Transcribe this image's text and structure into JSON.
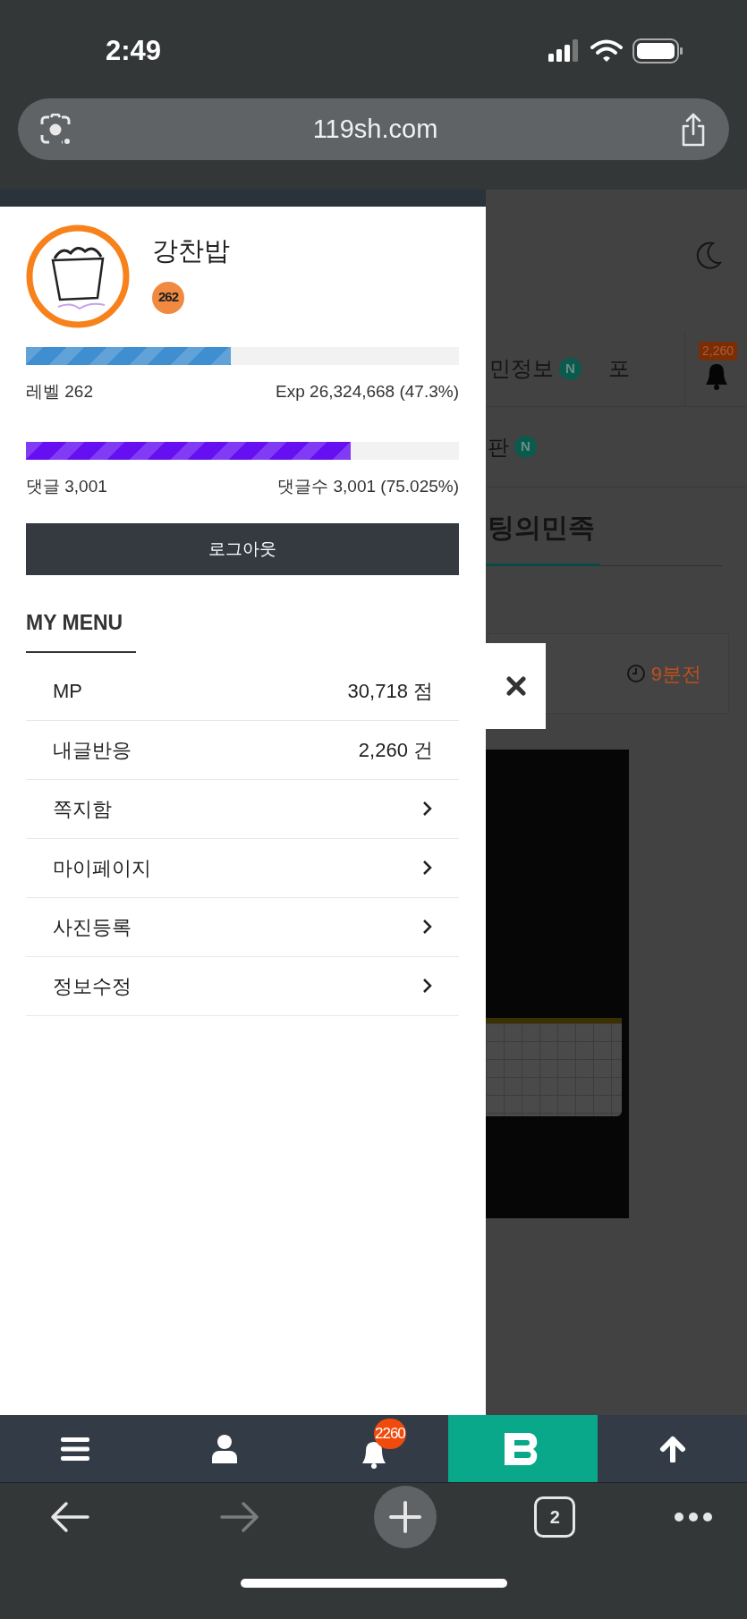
{
  "status_bar": {
    "time": "2:49"
  },
  "address_bar": {
    "url": "119sh.com"
  },
  "drawer": {
    "profile": {
      "name": "강찬밥",
      "level_badge": "262"
    },
    "progress": [
      {
        "level": 0.473,
        "color": "#3e8ed0",
        "left": "레벨 262",
        "right": "Exp 26,324,668 (47.3%)"
      },
      {
        "level": 0.75025,
        "color": "#6610f2",
        "left": "댓글 3,001",
        "right": "댓글수 3,001 (75.025%)"
      }
    ],
    "logout_button": "로그아웃",
    "menu_title": "MY MENU",
    "menu_items": [
      {
        "kind": "value",
        "label": "MP",
        "value": "30,718 점"
      },
      {
        "kind": "value",
        "label": "내글반응",
        "value": "2,260 건"
      },
      {
        "kind": "link",
        "label": "쪽지함"
      },
      {
        "kind": "link",
        "label": "마이페이지"
      },
      {
        "kind": "link",
        "label": "사진등록"
      },
      {
        "kind": "link",
        "label": "정보수정"
      }
    ]
  },
  "background_page": {
    "tabs_row_1": [
      {
        "label": "민정보",
        "badge": "N"
      },
      {
        "label": "포"
      }
    ],
    "bell_badge": "2,260",
    "tabs_row_2": [
      {
        "label": "판",
        "badge": "N"
      }
    ],
    "section_title": "팅의민족",
    "post_time": "9분전"
  },
  "bottom_nav": {
    "notification_count": "2260"
  },
  "browser_toolbar": {
    "forward_disabled": true,
    "tab_count": "2"
  }
}
